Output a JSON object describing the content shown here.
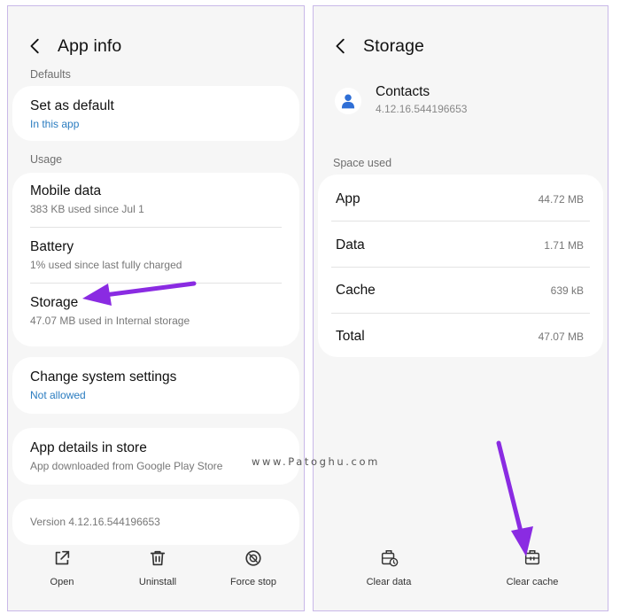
{
  "left": {
    "title": "App info",
    "defaults_label": "Defaults",
    "set_default": {
      "title": "Set as default",
      "sub": "In this app"
    },
    "usage_label": "Usage",
    "mobile_data": {
      "title": "Mobile data",
      "sub": "383 KB used since Jul 1"
    },
    "battery": {
      "title": "Battery",
      "sub": "1% used since last fully charged"
    },
    "storage": {
      "title": "Storage",
      "sub": "47.07 MB used in Internal storage"
    },
    "change_settings": {
      "title": "Change system settings",
      "sub": "Not allowed"
    },
    "app_details": {
      "title": "App details in store",
      "sub": "App downloaded from Google Play Store"
    },
    "version": "Version 4.12.16.544196653",
    "buttons": {
      "open": "Open",
      "uninstall": "Uninstall",
      "force_stop": "Force stop"
    }
  },
  "right": {
    "title": "Storage",
    "app_name": "Contacts",
    "app_version": "4.12.16.544196653",
    "space_used_label": "Space used",
    "rows": [
      {
        "key": "App",
        "value": "44.72 MB"
      },
      {
        "key": "Data",
        "value": "1.71 MB"
      },
      {
        "key": "Cache",
        "value": "639 kB"
      },
      {
        "key": "Total",
        "value": "47.07 MB"
      }
    ],
    "buttons": {
      "clear_data": "Clear data",
      "clear_cache": "Clear cache"
    }
  },
  "watermark": "www.Patoghu.com",
  "colors": {
    "accent_blue": "#2a7cc0",
    "arrow": "#8a2be2",
    "icon_blue": "#2f6fd6"
  },
  "icons": [
    "back-icon",
    "open-icon",
    "trash-icon",
    "stop-icon",
    "person-icon",
    "clear-data-icon",
    "clear-cache-icon"
  ]
}
